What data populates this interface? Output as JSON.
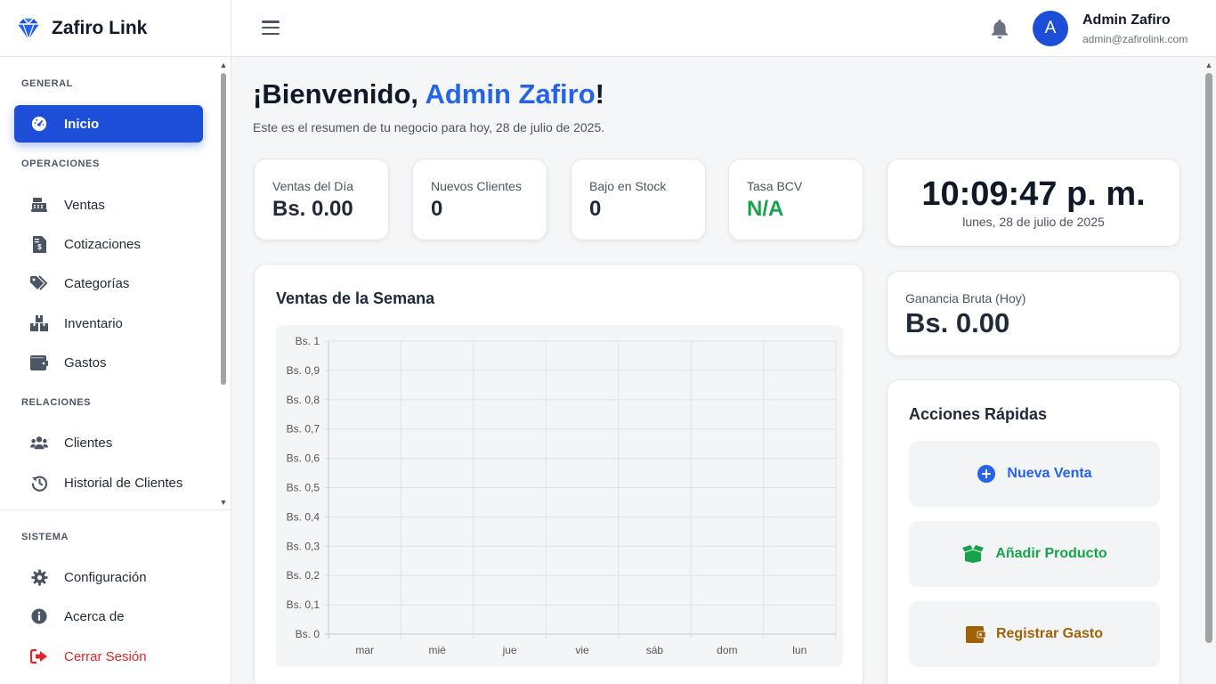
{
  "brand": {
    "name": "Zafiro Link"
  },
  "sidebar": {
    "sections": {
      "general": "GENERAL",
      "operaciones": "OPERACIONES",
      "relaciones": "RELACIONES",
      "sistema": "SISTEMA"
    },
    "items": {
      "inicio": "Inicio",
      "ventas": "Ventas",
      "cotizaciones": "Cotizaciones",
      "categorias": "Categorías",
      "inventario": "Inventario",
      "gastos": "Gastos",
      "clientes": "Clientes",
      "historial": "Historial de Clientes",
      "configuracion": "Configuración",
      "acerca": "Acerca de",
      "cerrar": "Cerrar Sesión"
    },
    "active_item": "Inicio"
  },
  "user": {
    "name": "Admin Zafiro",
    "email": "admin@zafirolink.com",
    "initial": "A"
  },
  "welcome": {
    "prefix": "¡Bienvenido, ",
    "name": "Admin Zafiro",
    "suffix": "!",
    "subtitle": "Este es el resumen de tu negocio para hoy, 28 de julio de 2025."
  },
  "stats": {
    "ventas_dia": {
      "label": "Ventas del Día",
      "value": "Bs. 0.00"
    },
    "nuevos_clientes": {
      "label": "Nuevos Clientes",
      "value": "0"
    },
    "bajo_stock": {
      "label": "Bajo en Stock",
      "value": "0"
    },
    "tasa_bcv": {
      "label": "Tasa BCV",
      "value": "N/A"
    }
  },
  "clock": {
    "time": "10:09:47 p. m.",
    "date": "lunes, 28 de julio de 2025"
  },
  "ganancia": {
    "label": "Ganancia Bruta (Hoy)",
    "value": "Bs. 0.00"
  },
  "quick_actions": {
    "title": "Acciones Rápidas",
    "nueva_venta": "Nueva Venta",
    "anadir_producto": "Añadir Producto",
    "registrar_gasto": "Registrar Gasto"
  },
  "colors": {
    "primary": "#1d4ed8",
    "accent_blue": "#2563eb",
    "success": "#16a34a",
    "danger": "#dc2626",
    "warning": "#a16207"
  },
  "chart_data": {
    "type": "bar",
    "title": "Ventas de la Semana",
    "categories": [
      "mar",
      "mié",
      "jue",
      "vie",
      "sáb",
      "dom",
      "lun"
    ],
    "values": [
      0,
      0,
      0,
      0,
      0,
      0,
      0
    ],
    "ylim": [
      0,
      1
    ],
    "y_ticks": [
      "Bs. 0",
      "Bs. 0,1",
      "Bs. 0,2",
      "Bs. 0,3",
      "Bs. 0,4",
      "Bs. 0,5",
      "Bs. 0,6",
      "Bs. 0,7",
      "Bs. 0,8",
      "Bs. 0,9",
      "Bs. 1"
    ],
    "grid": true,
    "legend": "none"
  }
}
